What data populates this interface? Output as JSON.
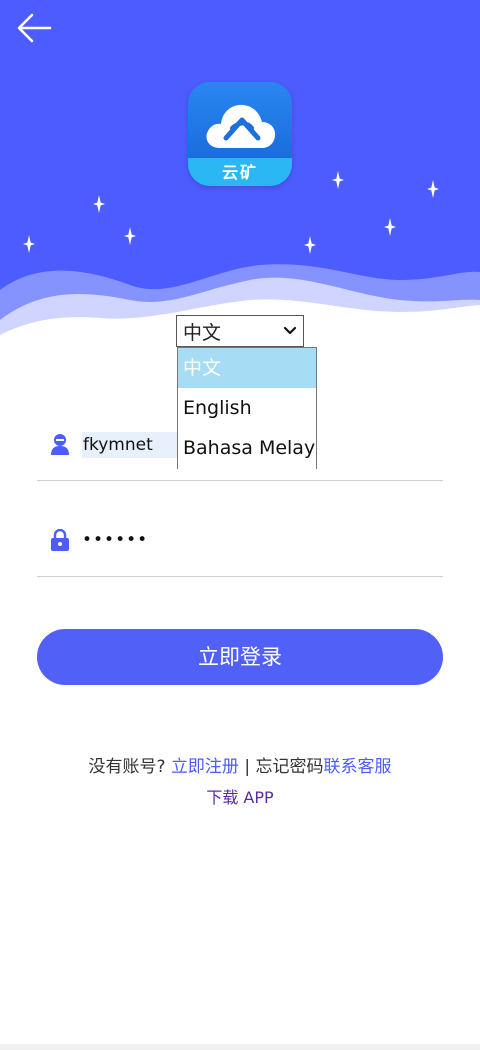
{
  "brand": {
    "logo_text": "云矿"
  },
  "language": {
    "selected": "中文",
    "options": [
      "中文",
      "English",
      "Bahasa Melayu"
    ]
  },
  "form": {
    "username_value": "fkymnet",
    "password_value": "••••••",
    "login_label": "立即登录"
  },
  "footer": {
    "no_account": "没有账号?",
    "register": "立即注册",
    "separator": " | ",
    "forgot": "忘记密码",
    "contact": "联系客服",
    "download": "下载 APP"
  },
  "colors": {
    "primary": "#4c5cff",
    "button": "#5161f8",
    "selected_option": "#a7dcf5"
  }
}
